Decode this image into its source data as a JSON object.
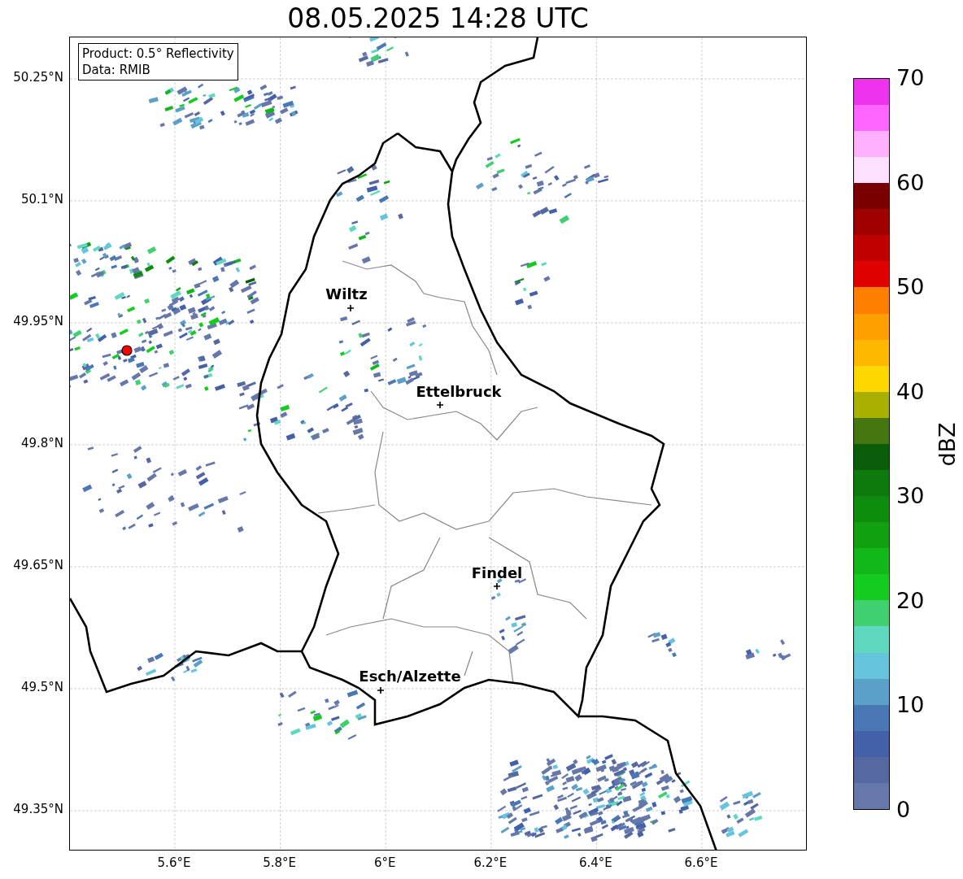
{
  "title": "08.05.2025 14:28 UTC",
  "info_box": {
    "lines": [
      "Product: 0.5° Reflectivity",
      "Data: RMIB"
    ]
  },
  "map": {
    "y_ticks": [
      "50.25°N",
      "50.1°N",
      "49.95°N",
      "49.8°N",
      "49.65°N",
      "49.5°N",
      "49.35°N"
    ],
    "x_ticks": [
      "5.6°E",
      "5.8°E",
      "6°E",
      "6.2°E",
      "6.4°E",
      "6.6°E"
    ],
    "cities": [
      {
        "name": "Wiltz"
      },
      {
        "name": "Ettelbruck"
      },
      {
        "name": "Findel"
      },
      {
        "name": "Esch/Alzette"
      }
    ]
  },
  "colorbar": {
    "label": "dBZ",
    "ticks": [
      "70",
      "60",
      "50",
      "40",
      "30",
      "20",
      "10",
      "0"
    ],
    "segments": [
      {
        "color": "#6677aa"
      },
      {
        "color": "#5568a0"
      },
      {
        "color": "#4460a8"
      },
      {
        "color": "#4a78b4"
      },
      {
        "color": "#5aa0c8"
      },
      {
        "color": "#66c4dc"
      },
      {
        "color": "#60d8c0"
      },
      {
        "color": "#40d070"
      },
      {
        "color": "#14cc20"
      },
      {
        "color": "#12b81a"
      },
      {
        "color": "#10a010"
      },
      {
        "color": "#0e8c0e"
      },
      {
        "color": "#0c7a0c"
      },
      {
        "color": "#0a5e0a"
      },
      {
        "color": "#447711"
      },
      {
        "color": "#aab000"
      },
      {
        "color": "#ffd700"
      },
      {
        "color": "#ffb800"
      },
      {
        "color": "#ff9f00"
      },
      {
        "color": "#ff8000"
      },
      {
        "color": "#e00000"
      },
      {
        "color": "#c00000"
      },
      {
        "color": "#a00000"
      },
      {
        "color": "#7a0000"
      },
      {
        "color": "#ffe0ff"
      },
      {
        "color": "#ffb0ff"
      },
      {
        "color": "#ff66ff"
      },
      {
        "color": "#ee33ee"
      }
    ]
  }
}
